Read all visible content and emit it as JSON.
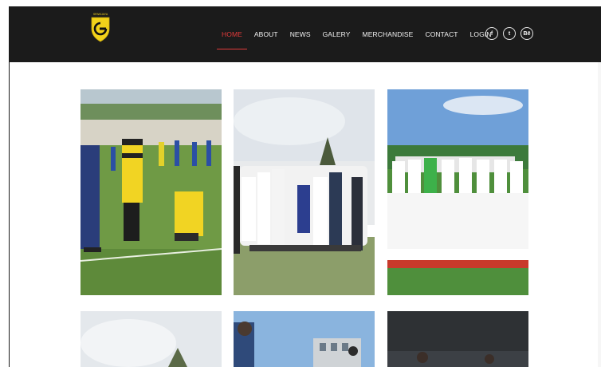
{
  "header": {
    "logo_icon": "club-crest-icon",
    "logo_text": "SRIWIJAYA",
    "nav": [
      {
        "label": "HOME",
        "active": true
      },
      {
        "label": "ABOUT",
        "active": false
      },
      {
        "label": "NEWS",
        "active": false
      },
      {
        "label": "GALERY",
        "active": false
      },
      {
        "label": "MERCHANDISE",
        "active": false
      },
      {
        "label": "CONTACT",
        "active": false
      },
      {
        "label": "LOGIN",
        "active": false
      }
    ],
    "social": [
      {
        "icon": "facebook-icon",
        "glyph": "f"
      },
      {
        "icon": "twitter-icon",
        "glyph": "t"
      },
      {
        "icon": "behance-icon",
        "glyph": "Bē"
      }
    ]
  },
  "gallery": {
    "images": [
      {
        "name": "photo-training-pitch",
        "alt": "Players on training pitch"
      },
      {
        "name": "photo-team-celebration",
        "alt": "Team celebration group"
      },
      {
        "name": "photo-team-lineup",
        "alt": "Team lineup photo"
      },
      {
        "name": "photo-sky-field",
        "alt": "Field with sky"
      },
      {
        "name": "photo-player-stadium",
        "alt": "Player by stadium"
      },
      {
        "name": "photo-dark-stadium",
        "alt": "Players in dark stadium"
      }
    ]
  },
  "colors": {
    "nav_bg": "#1b1b1b",
    "accent": "#e23b3b",
    "crest_yellow": "#f2d21a"
  }
}
